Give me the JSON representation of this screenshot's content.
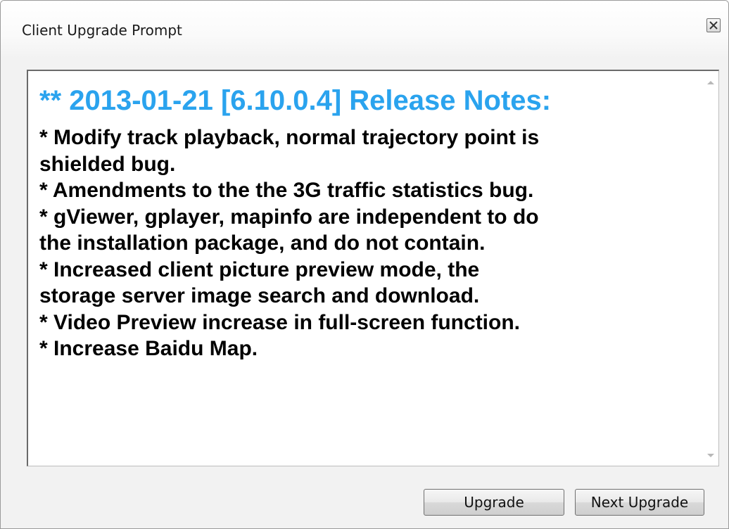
{
  "dialog": {
    "title": "Client Upgrade Prompt",
    "close_icon": "close-icon"
  },
  "notes": {
    "heading": "** 2013-01-21 [6.10.0.4] Release Notes:",
    "heading_color": "#2aa3ee",
    "lines": [
      "* Modify track playback, normal trajectory point is",
      "shielded bug.",
      "* Amendments to the the 3G traffic statistics bug.",
      "* gViewer, gplayer, mapinfo are independent to do",
      "the installation package, and do not contain.",
      "* Increased client picture preview mode, the",
      "storage server image search and download.",
      "* Video Preview increase in full-screen function.",
      "* Increase Baidu Map."
    ]
  },
  "scrollbar": {
    "up_icon": "scroll-up-arrow-icon",
    "down_icon": "scroll-down-arrow-icon"
  },
  "buttons": {
    "upgrade_label": "Upgrade",
    "next_upgrade_label": "Next Upgrade"
  }
}
